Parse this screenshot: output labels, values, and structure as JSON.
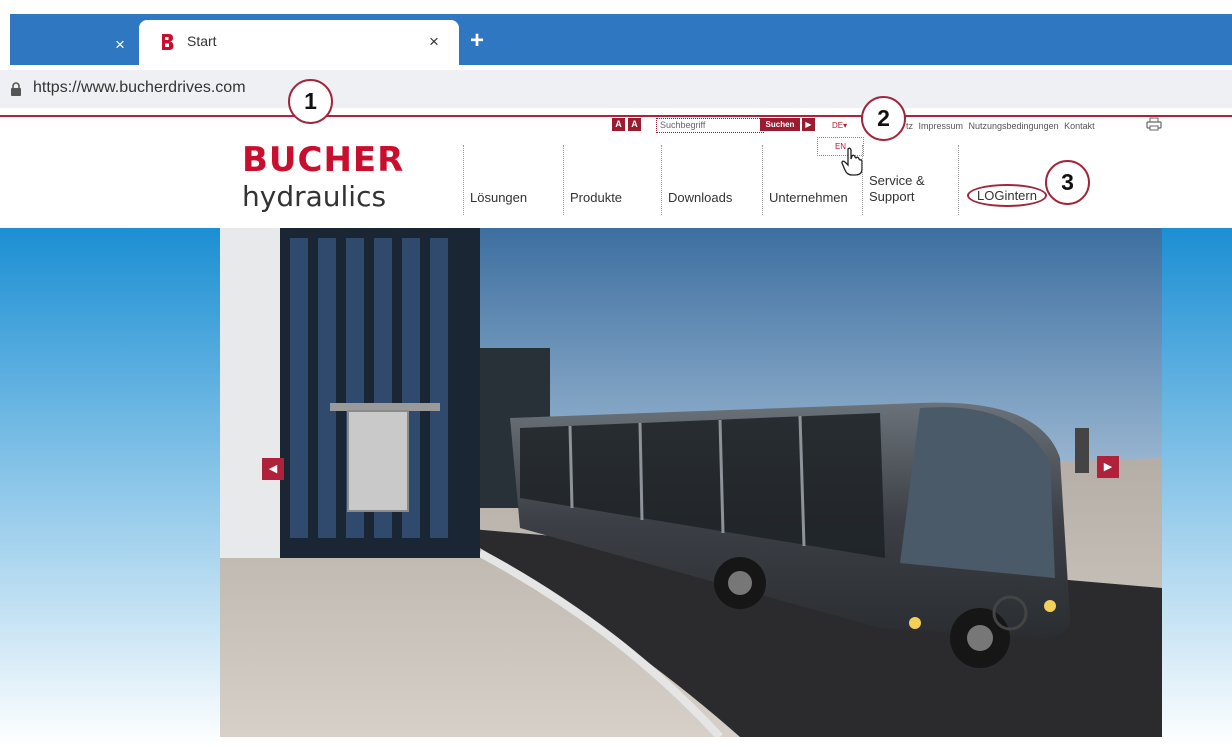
{
  "browser": {
    "tabs": [
      {
        "title": "",
        "close_label": "×"
      },
      {
        "title": "Start",
        "close_label": "×"
      }
    ],
    "new_tab_label": "+",
    "url": "https://www.bucherdrives.com"
  },
  "callouts": [
    "1",
    "2",
    "3"
  ],
  "site": {
    "font_size_buttons": [
      "A",
      "A"
    ],
    "search": {
      "placeholder": "Suchbegriff",
      "button_label": "Suchen",
      "arrow": "▶"
    },
    "language": {
      "current": "DE▾",
      "options": [
        "EN"
      ]
    },
    "utility_links": "tz  Impressum  Nutzungsbedingungen  Kontakt",
    "logo": {
      "main": "BUCHER",
      "sub": "hydraulics"
    },
    "nav": [
      "Lösungen",
      "Produkte",
      "Downloads",
      "Unternehmen",
      "Service & Support"
    ],
    "login_label": "LOGintern",
    "slider": {
      "prev": "◀",
      "next": "▶"
    }
  },
  "colors": {
    "brand": "#c8102e",
    "tabbar": "#2f77c0",
    "accent": "#b0213a"
  }
}
